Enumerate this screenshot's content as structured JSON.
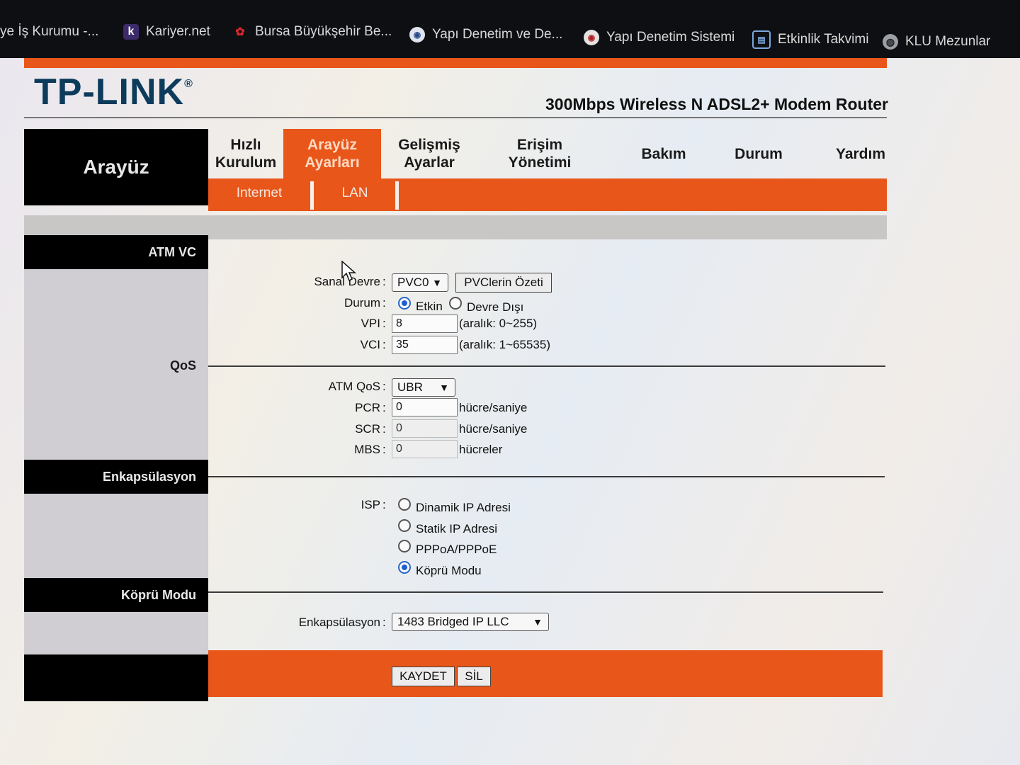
{
  "bookmarks": [
    {
      "label": "ye İş Kurumu -...",
      "icon": "none"
    },
    {
      "label": "Kariyer.net",
      "icon": "kariyer-k-icon"
    },
    {
      "label": "Bursa Büyükşehir Be...",
      "icon": "bursa-logo-icon"
    },
    {
      "label": "Yapı Denetim ve De...",
      "icon": "seal-icon"
    },
    {
      "label": "Yapı Denetim Sistemi",
      "icon": "seal-icon"
    },
    {
      "label": "Etkinlik Takvimi",
      "icon": "calendar-icon"
    },
    {
      "label": "KLU Mezunlar",
      "icon": "globe-icon"
    }
  ],
  "header": {
    "logo": "TP-LINK",
    "logo_mark": "®",
    "model": "300Mbps Wireless N ADSL2+ Modem Router"
  },
  "sidebar_title": "Arayüz",
  "nav": [
    {
      "label_l1": "Hızlı",
      "label_l2": "Kurulum"
    },
    {
      "label_l1": "Arayüz",
      "label_l2": "Ayarları",
      "active": true
    },
    {
      "label_l1": "Gelişmiş",
      "label_l2": "Ayarlar"
    },
    {
      "label_l1": "Erişim",
      "label_l2": "Yönetimi"
    },
    {
      "label_l1": "Bakım",
      "label_l2": ""
    },
    {
      "label_l1": "Durum",
      "label_l2": ""
    },
    {
      "label_l1": "Yardım",
      "label_l2": ""
    }
  ],
  "subnav": [
    "Internet",
    "LAN"
  ],
  "sections": {
    "atm_vc": "ATM VC",
    "qos": "QoS",
    "encapsulation": "Enkapsülasyon",
    "bridge": "Köprü Modu"
  },
  "atm_vc": {
    "virtual_circuit_label": "Sanal Devre",
    "virtual_circuit_value": "PVC0",
    "summary_button": "PVClerin Özeti",
    "status_label": "Durum",
    "status_on": "Etkin",
    "status_off": "Devre Dışı",
    "status_selected": "Etkin",
    "vpi_label": "VPI",
    "vpi_value": "8",
    "vpi_hint": "(aralık: 0~255)",
    "vci_label": "VCI",
    "vci_value": "35",
    "vci_hint": "(aralık: 1~65535)"
  },
  "qos": {
    "atm_qos_label": "ATM QoS",
    "atm_qos_value": "UBR",
    "pcr_label": "PCR",
    "pcr_value": "0",
    "pcr_unit": "hücre/saniye",
    "scr_label": "SCR",
    "scr_value": "0",
    "scr_unit": "hücre/saniye",
    "mbs_label": "MBS",
    "mbs_value": "0",
    "mbs_unit": "hücreler"
  },
  "isp": {
    "label": "ISP",
    "options": [
      "Dinamik IP Adresi",
      "Statik IP Adresi",
      "PPPoA/PPPoE",
      "Köprü Modu"
    ],
    "selected": "Köprü Modu"
  },
  "bridge": {
    "encap_label": "Enkapsülasyon",
    "encap_value": "1483 Bridged IP LLC"
  },
  "separator": ":",
  "buttons": {
    "save": "KAYDET",
    "delete": "SİL"
  }
}
